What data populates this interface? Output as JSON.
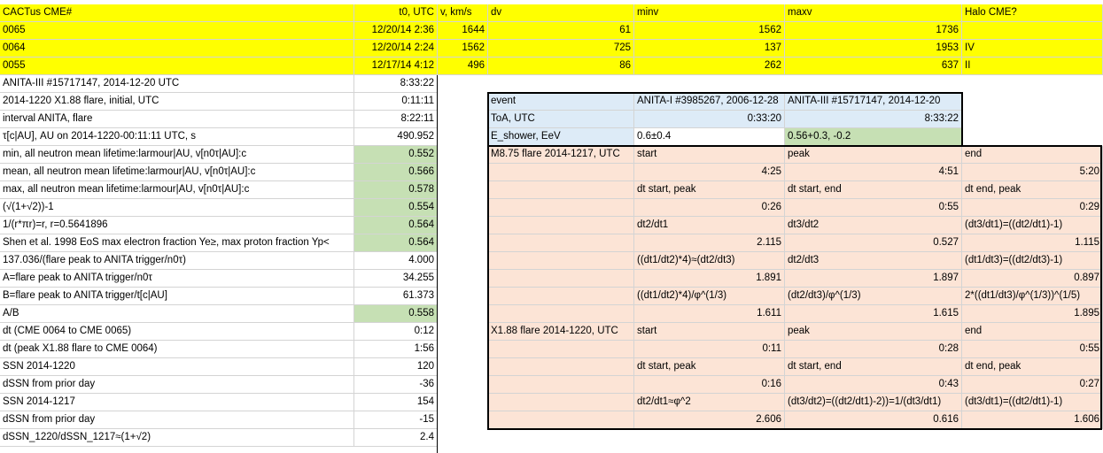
{
  "header": {
    "cols": [
      "CACTus CME#",
      "t0, UTC",
      "v, km/s",
      "dv",
      "minv",
      "maxv",
      "Halo CME?"
    ]
  },
  "cme_rows": [
    [
      "0065",
      "12/20/14 2:36",
      "1644",
      "61",
      "1562",
      "1736",
      ""
    ],
    [
      "0064",
      "12/20/14 2:24",
      "1562",
      "725",
      "137",
      "1953",
      "IV"
    ],
    [
      "0055",
      "12/17/14 4:12",
      "496",
      "86",
      "262",
      "637",
      "II"
    ]
  ],
  "left_rows": [
    {
      "label": "ANITA-III #15717147, 2014-12-20 UTC",
      "value": "8:33:22"
    },
    {
      "label": "2014-1220 X1.88 flare, initial, UTC",
      "value": "0:11:11"
    },
    {
      "label": "interval ANITA, flare",
      "value": "8:22:11"
    },
    {
      "label": "τ[c|AU], AU on 2014-1220-00:11:11 UTC, s",
      "value": "490.952"
    },
    {
      "label": "min, all neutron mean lifetime:larmour|AU,  v[n0τ|AU]:c",
      "value": "0.552"
    },
    {
      "label": "mean, all neutron mean lifetime:larmour|AU,  v[n0τ|AU]:c",
      "value": "0.566"
    },
    {
      "label": "max, all neutron mean lifetime:larmour|AU,  v[n0τ|AU]:c",
      "value": "0.578"
    },
    {
      "label": "(√(1+√2))-1",
      "value": "0.554"
    },
    {
      "label": "1/(r*πr)=r, r=0.5641896",
      "value": "0.564"
    },
    {
      "label": "Shen et al. 1998 EoS max electron fraction Ye≥, max proton fraction Yp<",
      "value": "0.564"
    },
    {
      "label": "137.036/(flare peak to ANITA trigger/n0τ)",
      "value": "4.000"
    },
    {
      "label": "A=flare peak to ANITA trigger/n0τ",
      "value": "34.255"
    },
    {
      "label": "B=flare peak to ANITA trigger/t[c|AU]",
      "value": "61.373"
    },
    {
      "label": "A/B",
      "value": "0.558"
    },
    {
      "label": "dt (CME 0064 to CME 0065)",
      "value": "0:12"
    },
    {
      "label": "dt (peak X1.88 flare to CME 0064)",
      "value": "1:56"
    },
    {
      "label": "SSN 2014-1220",
      "value": "120"
    },
    {
      "label": "dSSN from prior day",
      "value": "-36"
    },
    {
      "label": "SSN 2014-1217",
      "value": "154"
    },
    {
      "label": "dSSN from prior day",
      "value": "-15"
    },
    {
      "label": "dSSN_1220/dSSN_1217≈(1+√2)",
      "value": "2.4"
    }
  ],
  "event_table": [
    [
      "event",
      "ANITA-I #3985267, 2006-12-28",
      "ANITA-III #15717147, 2014-12-20"
    ],
    [
      "ToA, UTC",
      "0:33:20",
      "8:33:22"
    ],
    [
      "E_shower, EeV",
      "0.6±0.4",
      "0.56+0.3, -0.2"
    ]
  ],
  "flare_table": [
    [
      "M8.75 flare 2014-1217, UTC",
      "start",
      "peak",
      "end"
    ],
    [
      "",
      "4:25",
      "4:51",
      "5:20"
    ],
    [
      "",
      "dt start, peak",
      "dt start, end",
      "dt end, peak"
    ],
    [
      "",
      "0:26",
      "0:55",
      "0:29"
    ],
    [
      "",
      "dt2/dt1",
      "dt3/dt2",
      "(dt3/dt1)=((dt2/dt1)-1)"
    ],
    [
      "",
      "2.115",
      "0.527",
      "1.115"
    ],
    [
      "",
      "((dt1/dt2)*4)≈(dt2/dt3)",
      "dt2/dt3",
      "(dt1/dt3)=((dt2/dt3)-1)"
    ],
    [
      "",
      "1.891",
      "1.897",
      "0.897"
    ],
    [
      "",
      "((dt1/dt2)*4)/φ^(1/3)",
      "(dt2/dt3)/φ^(1/3)",
      "2*((dt1/dt3)/φ^(1/3))^(1/5)"
    ],
    [
      "",
      "1.611",
      "1.615",
      "1.895"
    ],
    [
      "X1.88 flare 2014-1220, UTC",
      "start",
      "peak",
      "end"
    ],
    [
      "",
      "0:11",
      "0:28",
      "0:55"
    ],
    [
      "",
      "dt start, peak",
      "dt start, end",
      "dt end, peak"
    ],
    [
      "",
      "0:16",
      "0:43",
      "0:27"
    ],
    [
      "",
      "dt2/dt1≈φ^2",
      "(dt3/dt2)=((dt2/dt1)-2))=1/(dt3/dt1)",
      "(dt3/dt1)=((dt2/dt1)-1)"
    ],
    [
      "",
      "2.606",
      "0.616",
      "1.606"
    ]
  ],
  "colors": {
    "header_fill": "#ffff00",
    "green_fill": "#c6e0b4",
    "blue_fill": "#ddebf7",
    "peach_fill": "#fce4d6",
    "gridline": "#d4d4d4"
  }
}
